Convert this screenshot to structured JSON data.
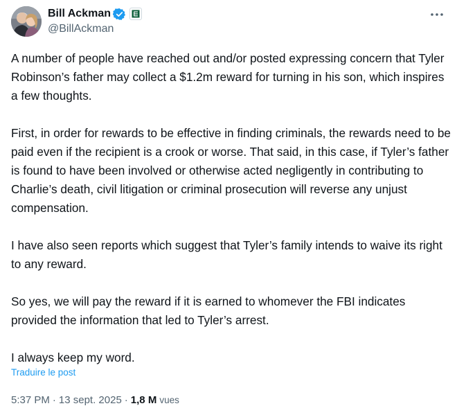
{
  "author": {
    "display_name": "Bill Ackman",
    "handle": "@BillAckman",
    "verified_icon": "verified-badge-icon",
    "affiliate_icon": "affiliate-badge-icon",
    "verified_color": "#1d9bf0",
    "affiliate_color": "#0b5e3a"
  },
  "more_icon": "more-horizontal-icon",
  "post": {
    "paragraphs": [
      "A number of people have reached out and/or posted expressing concern that Tyler Robinson’s father may collect a $1.2m reward for turning in his son, which inspires a few thoughts.",
      "First, in order for rewards to be effective in finding criminals, the rewards need to be paid even if the recipient is a crook or worse. That said, in this case, if Tyler’s father is found to have been involved or otherwise acted negligently in contributing to Charlie’s death, civil litigation or criminal prosecution will reverse any unjust compensation.",
      "I have also seen reports which suggest that Tyler’s family intends to waive its right to any reward.",
      "So yes, we will pay the reward if it is earned to whomever the FBI indicates provided the information that led to Tyler’s arrest.",
      "I always keep my word."
    ],
    "translate_label": "Traduire le post"
  },
  "meta": {
    "time": "5:37 PM",
    "separator": "·",
    "date": "13 sept. 2025",
    "views_count": "1,8 M",
    "views_label": "vues"
  },
  "colors": {
    "text": "#0f1419",
    "secondary": "#536471",
    "link": "#1d9bf0"
  }
}
